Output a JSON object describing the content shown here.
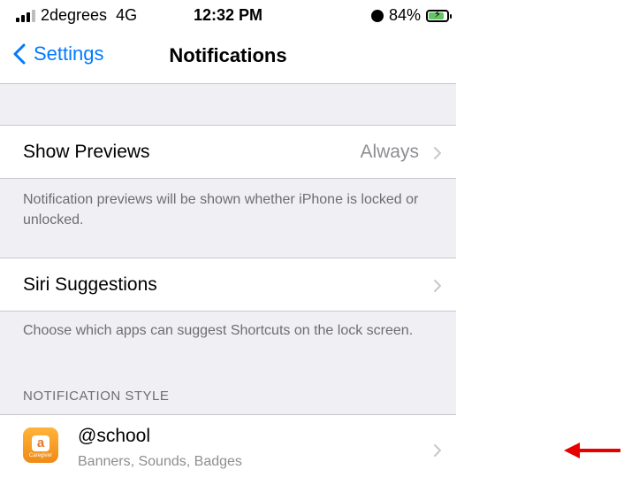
{
  "status_bar": {
    "carrier": "2degrees",
    "network": "4G",
    "time": "12:32 PM",
    "battery_percent": "84%",
    "battery_level": 0.84,
    "icons": [
      "signal-icon",
      "alarm-icon",
      "battery-charging-icon"
    ]
  },
  "nav": {
    "back_label": "Settings",
    "title": "Notifications"
  },
  "show_previews": {
    "label": "Show Previews",
    "value": "Always",
    "footer": "Notification previews will be shown whether iPhone is locked or unlocked."
  },
  "siri_suggestions": {
    "label": "Siri Suggestions",
    "footer": "Choose which apps can suggest Shortcuts on the lock screen."
  },
  "notification_style": {
    "header": "NOTIFICATION STYLE",
    "apps": [
      {
        "name": "@school",
        "subtitle": "Banners, Sounds, Badges",
        "icon_caption": "Caregiver",
        "icon_glyph": "a"
      }
    ]
  },
  "colors": {
    "accent": "#007aff",
    "annotation": "#e60000",
    "app_icon": "#f59a23"
  }
}
